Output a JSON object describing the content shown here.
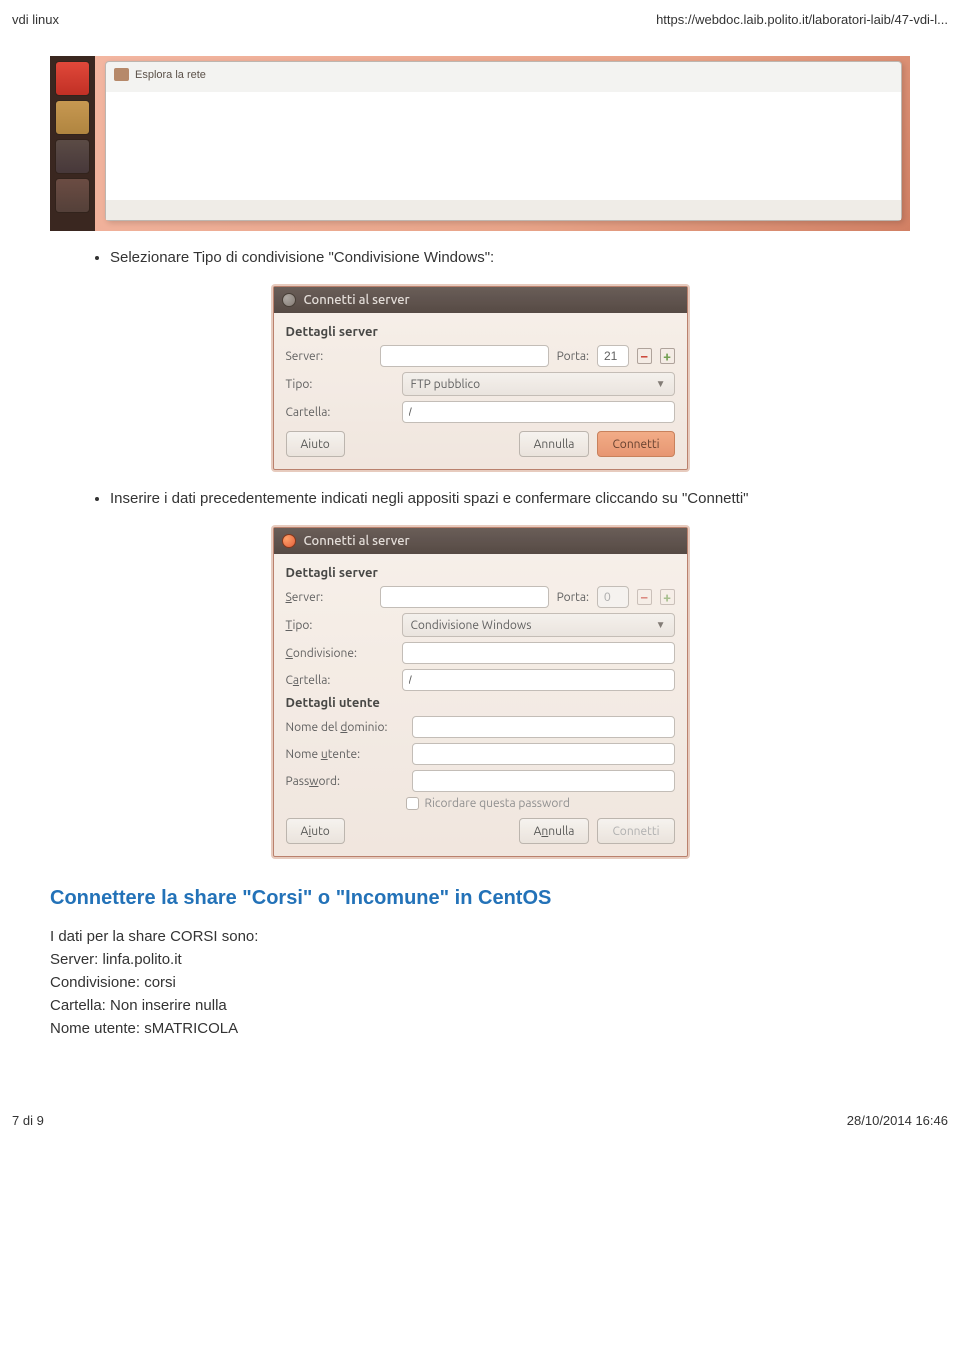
{
  "header": {
    "left": "vdi linux",
    "right": "https://webdoc.laib.polito.it/laboratori-laib/47-vdi-l..."
  },
  "ubuntu": {
    "explore_network": "Esplora la rete"
  },
  "bullet1": "Selezionare Tipo di condivisione \"Condivisione Windows\":",
  "dialog1": {
    "title": "Connetti al server",
    "section": "Dettagli server",
    "server": "Server:",
    "porta": "Porta:",
    "porta_val": "21",
    "tipo": "Tipo:",
    "tipo_val": "FTP pubblico",
    "cartella": "Cartella:",
    "cartella_val": "/",
    "aiuto": "Aiuto",
    "annulla": "Annulla",
    "connetti": "Connetti"
  },
  "bullet2": "Inserire i dati precedentemente indicati negli appositi spazi e confermare cliccando su \"Connetti\"",
  "dialog2": {
    "title": "Connetti al server",
    "section1": "Dettagli server",
    "server": "Server:",
    "porta": "Porta:",
    "porta_val": "0",
    "tipo": "Tipo:",
    "tipo_val": "Condivisione Windows",
    "cond": "Condivisione:",
    "cartella": "Cartella:",
    "cartella_val": "/",
    "section2": "Dettagli utente",
    "dominio": "Nome del dominio:",
    "utente": "Nome utente:",
    "password": "Password:",
    "remember": "Ricordare questa password",
    "aiuto": "Aiuto",
    "annulla": "Annulla",
    "connetti": "Connetti"
  },
  "section_title": "Connettere la share \"Corsi\" o \"Incomune\" in CentOS",
  "intro": "I dati per la share CORSI sono:",
  "lines": {
    "l1": "Server: linfa.polito.it",
    "l2": "Condivisione: corsi",
    "l3": "Cartella: Non inserire nulla",
    "l4": "Nome utente: sMATRICOLA"
  },
  "footer": {
    "left": "7 di 9",
    "right": "28/10/2014 16:46"
  }
}
